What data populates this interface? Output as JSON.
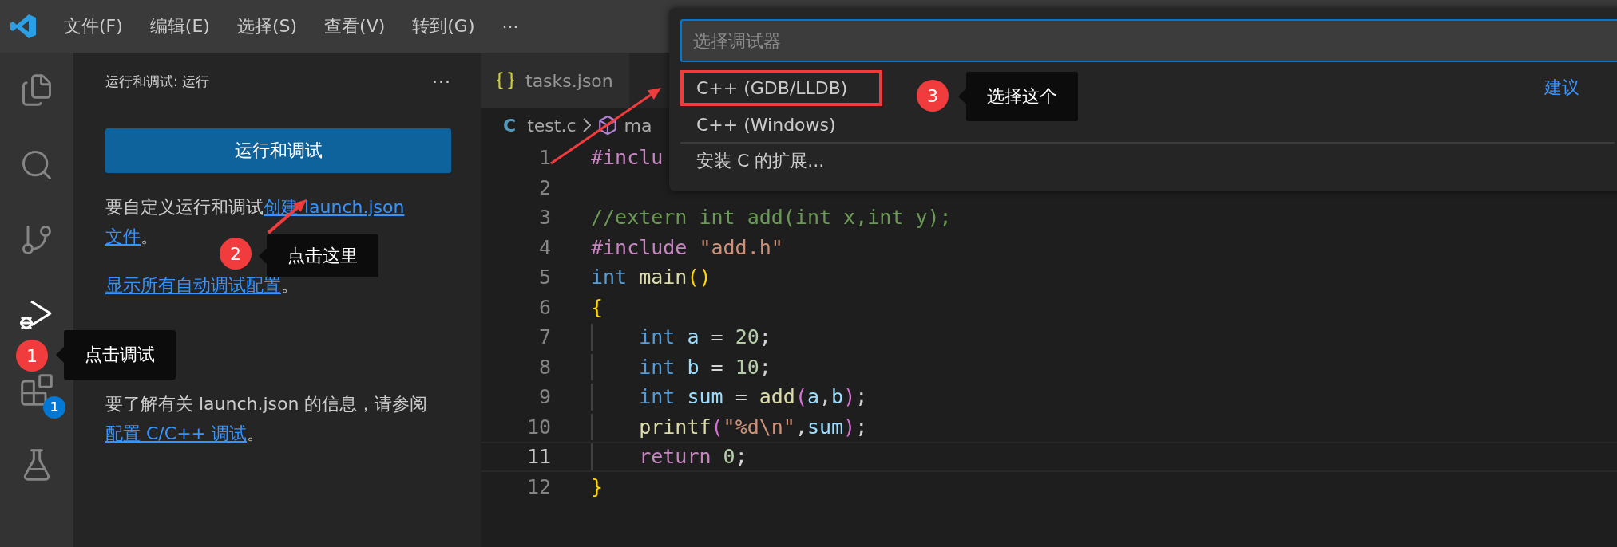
{
  "menu": {
    "items": [
      {
        "label": "文件(F)"
      },
      {
        "label": "编辑(E)"
      },
      {
        "label": "选择(S)"
      },
      {
        "label": "查看(V)"
      },
      {
        "label": "转到(G)"
      }
    ],
    "more": "···"
  },
  "activity_bar": [
    {
      "kind": "explorer",
      "selected": false
    },
    {
      "kind": "search",
      "selected": false
    },
    {
      "kind": "source-control",
      "selected": false
    },
    {
      "kind": "run",
      "selected": true
    },
    {
      "kind": "extensions",
      "selected": false,
      "badge": "1"
    },
    {
      "kind": "testing",
      "selected": false
    }
  ],
  "sidebar": {
    "title": "运行和调试: 运行",
    "more": "···",
    "button": "运行和调试",
    "paragraphs": [
      [
        {
          "text": "要自定义运行和调试",
          "link": false
        },
        {
          "text": "创建 launch.json",
          "link": true
        },
        {
          "text": "文件",
          "link": true
        },
        {
          "text": "。",
          "link": false
        }
      ],
      [
        {
          "text": "显示所有自动调试配置",
          "link": true
        },
        {
          "text": "。",
          "link": false
        }
      ],
      [
        {
          "text": "要了解有关 launch.json 的信息，请参阅 ",
          "link": false
        },
        {
          "text": "配置 C/C++ 调试",
          "link": true
        },
        {
          "text": "。",
          "link": false
        }
      ]
    ]
  },
  "editor": {
    "tabs": [
      {
        "label": "tasks.json",
        "selected": false
      }
    ],
    "breadcrumb": {
      "file_badge": "C",
      "file": "test.c",
      "symbol": "ma"
    },
    "lines": [
      {
        "number": "1",
        "current": false,
        "indent_guide": false,
        "tokens": [
          {
            "text": "#inclu",
            "kind": "keyword"
          }
        ]
      },
      {
        "number": "2",
        "current": false,
        "indent_guide": false
      },
      {
        "number": "3",
        "current": false,
        "indent_guide": false,
        "tokens": [
          {
            "text": "//extern int add(int x,int y);",
            "kind": "comment"
          }
        ]
      },
      {
        "number": "4",
        "current": false,
        "indent_guide": false,
        "tokens": [
          {
            "text": "#include ",
            "kind": "keyword"
          },
          {
            "text": "\"add.h\"",
            "kind": "string"
          }
        ]
      },
      {
        "number": "5",
        "current": false,
        "indent_guide": false,
        "tokens": [
          {
            "text": "int ",
            "kind": "type"
          },
          {
            "text": "main",
            "kind": "function"
          },
          {
            "text": "()",
            "kind": "bracket1"
          }
        ]
      },
      {
        "number": "6",
        "current": false,
        "indent_guide": false,
        "tokens": [
          {
            "text": "{",
            "kind": "bracket1"
          }
        ]
      },
      {
        "number": "7",
        "current": false,
        "indent_guide": true,
        "tokens": [
          {
            "text": "    int ",
            "kind": "type"
          },
          {
            "text": "a",
            "kind": "variable"
          },
          {
            "text": " = ",
            "kind": "plain"
          },
          {
            "text": "20",
            "kind": "number"
          },
          {
            "text": ";",
            "kind": "plain"
          }
        ]
      },
      {
        "number": "8",
        "current": false,
        "indent_guide": true,
        "tokens": [
          {
            "text": "    int ",
            "kind": "type"
          },
          {
            "text": "b",
            "kind": "variable"
          },
          {
            "text": " = ",
            "kind": "plain"
          },
          {
            "text": "10",
            "kind": "number"
          },
          {
            "text": ";",
            "kind": "plain"
          }
        ]
      },
      {
        "number": "9",
        "current": false,
        "indent_guide": true,
        "tokens": [
          {
            "text": "    int ",
            "kind": "type"
          },
          {
            "text": "sum",
            "kind": "variable"
          },
          {
            "text": " = ",
            "kind": "plain"
          },
          {
            "text": "add",
            "kind": "function"
          },
          {
            "text": "(",
            "kind": "bracket2"
          },
          {
            "text": "a",
            "kind": "variable"
          },
          {
            "text": ",",
            "kind": "plain"
          },
          {
            "text": "b",
            "kind": "variable"
          },
          {
            "text": ")",
            "kind": "bracket2"
          },
          {
            "text": ";",
            "kind": "plain"
          }
        ]
      },
      {
        "number": "10",
        "current": false,
        "indent_guide": true,
        "tokens": [
          {
            "text": "    printf",
            "kind": "function"
          },
          {
            "text": "(",
            "kind": "bracket2"
          },
          {
            "text": "\"%d\\n\"",
            "kind": "string"
          },
          {
            "text": ",",
            "kind": "plain"
          },
          {
            "text": "sum",
            "kind": "variable"
          },
          {
            "text": ")",
            "kind": "bracket2"
          },
          {
            "text": ";",
            "kind": "plain"
          }
        ]
      },
      {
        "number": "11",
        "current": true,
        "indent_guide": true,
        "tokens": [
          {
            "text": "    return ",
            "kind": "keyword"
          },
          {
            "text": "0",
            "kind": "number"
          },
          {
            "text": ";",
            "kind": "plain"
          }
        ]
      },
      {
        "number": "12",
        "current": false,
        "indent_guide": false,
        "tokens": [
          {
            "text": "}",
            "kind": "bracket1"
          }
        ]
      }
    ]
  },
  "quick_pick": {
    "placeholder": "选择调试器",
    "items": [
      {
        "label": "C++ (GDB/LLDB)",
        "tag": "建议",
        "marked": true,
        "separator_above": false
      },
      {
        "label": "C++ (Windows)",
        "marked": false,
        "separator_above": false
      },
      {
        "label": "安装 C 的扩展...",
        "marked": false,
        "separator_above": true
      }
    ]
  },
  "annotations": [
    {
      "number": "1",
      "label": "点击调试"
    },
    {
      "number": "2",
      "label": "点击这里"
    },
    {
      "number": "3",
      "label": "选择这个"
    }
  ]
}
